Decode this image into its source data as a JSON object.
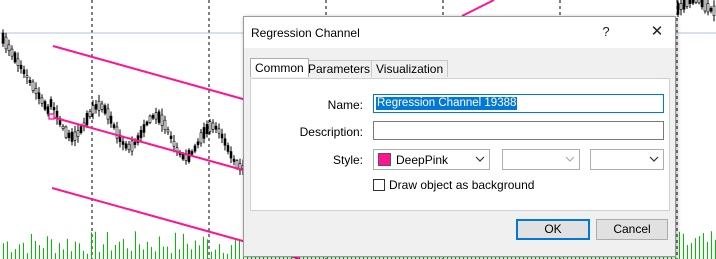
{
  "dialog": {
    "title": "Regression Channel",
    "help_glyph": "?",
    "close_glyph": "✕",
    "tabs": [
      {
        "label": "Common",
        "active": true
      },
      {
        "label": "Parameters",
        "active": false
      },
      {
        "label": "Visualization",
        "active": false
      }
    ],
    "fields": {
      "name_label": "Name:",
      "name_value": "Regression Channel 19388",
      "description_label": "Description:",
      "description_value": "",
      "style_label": "Style:",
      "color_name": "DeepPink",
      "color_hex": "#ff1493",
      "line_style": "solid",
      "line_width": "thick"
    },
    "checkbox": {
      "label": "Draw object as background",
      "checked": false
    },
    "buttons": {
      "ok": "OK",
      "cancel": "Cancel"
    }
  },
  "chart": {
    "channel_color": "#ff1493",
    "bar_color": "#000000",
    "volume_color": "#00c000",
    "grid_color": "#000000",
    "level_line_color": "#b0c4d8"
  }
}
